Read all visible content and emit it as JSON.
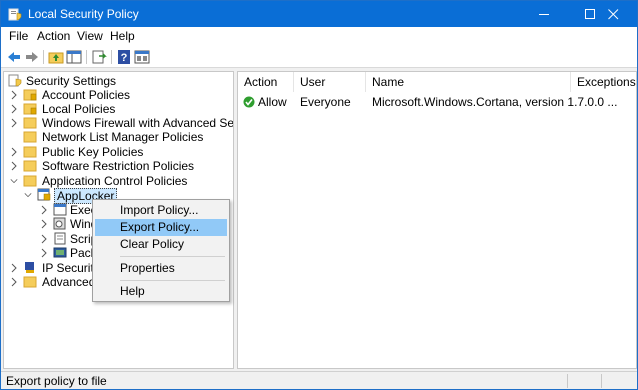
{
  "window": {
    "title": "Local Security Policy"
  },
  "menu": [
    "File",
    "Action",
    "View",
    "Help"
  ],
  "toolbar_icons": [
    "back-arrow-icon",
    "forward-arrow-icon",
    "up-folder-icon",
    "console-tree-icon",
    "export-list-icon",
    "help-icon",
    "properties-icon"
  ],
  "tree": {
    "root": "Security Settings",
    "items": [
      {
        "label": "Account Policies",
        "icon": "folder-key-icon"
      },
      {
        "label": "Local Policies",
        "icon": "folder-key-icon"
      },
      {
        "label": "Windows Firewall with Advanced Security",
        "icon": "folder-icon"
      },
      {
        "label": "Network List Manager Policies",
        "icon": "folder-icon"
      },
      {
        "label": "Public Key Policies",
        "icon": "folder-icon"
      },
      {
        "label": "Software Restriction Policies",
        "icon": "folder-icon"
      },
      {
        "label": "Application Control Policies",
        "icon": "folder-icon"
      },
      {
        "label": "AppLocker",
        "icon": "applocker-icon"
      },
      {
        "label": "Execu",
        "icon": "executable-rules-icon"
      },
      {
        "label": "Windo",
        "icon": "installer-rules-icon"
      },
      {
        "label": "Scrip",
        "icon": "script-rules-icon"
      },
      {
        "label": "Pack",
        "icon": "packaged-app-rules-icon"
      },
      {
        "label": "IP Security P",
        "icon": "ip-security-icon"
      },
      {
        "label": "Advanced A",
        "icon": "folder-icon"
      }
    ]
  },
  "list": {
    "columns": [
      "Action",
      "User",
      "Name",
      "Exceptions"
    ],
    "rows": [
      {
        "action": "Allow",
        "user": "Everyone",
        "name": "Microsoft.Windows.Cortana, version 1.7.0.0 ...",
        "exceptions": ""
      }
    ]
  },
  "context_menu": {
    "items": [
      "Import Policy...",
      "Export Policy...",
      "Clear Policy",
      "Properties",
      "Help"
    ],
    "highlighted": "Export Policy..."
  },
  "status": {
    "text": "Export policy to file"
  },
  "colors": {
    "titlebar": "#0a6ed6",
    "highlight": "#91c9f7",
    "selection": "#cce8ff",
    "allow_green": "#2f9e2f"
  }
}
